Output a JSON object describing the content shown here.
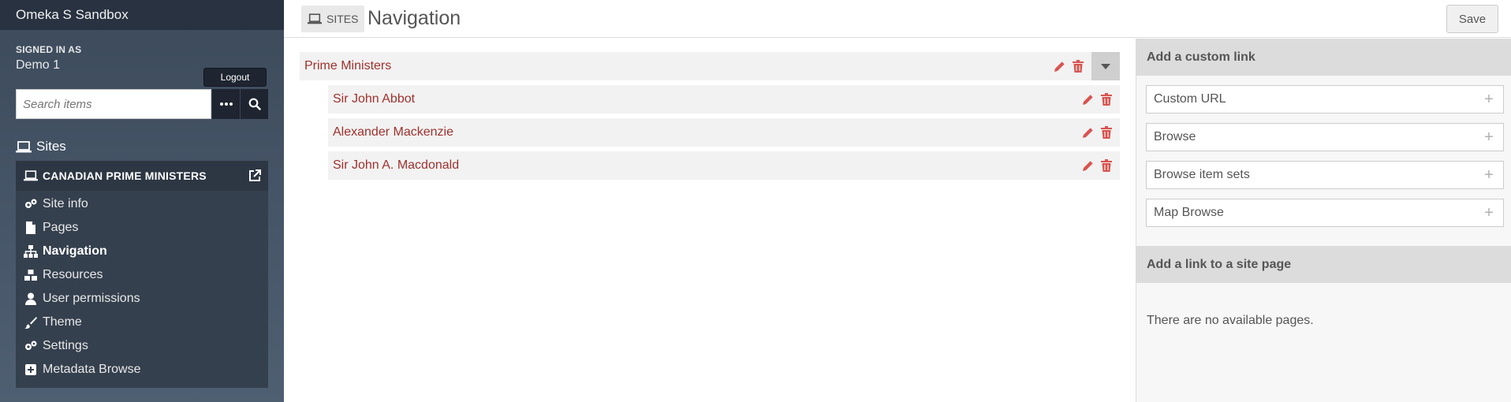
{
  "app": {
    "title": "Omeka S Sandbox"
  },
  "user": {
    "signed_in_label": "SIGNED IN AS",
    "name": "Demo 1",
    "logout_label": "Logout"
  },
  "search": {
    "placeholder": "Search items"
  },
  "sidebar": {
    "sites_label": "Sites",
    "current_site": "CANADIAN PRIME MINISTERS",
    "items": [
      {
        "label": "Site info",
        "icon": "gears-icon"
      },
      {
        "label": "Pages",
        "icon": "file-icon"
      },
      {
        "label": "Navigation",
        "icon": "sitemap-icon"
      },
      {
        "label": "Resources",
        "icon": "cubes-icon"
      },
      {
        "label": "User permissions",
        "icon": "user-icon"
      },
      {
        "label": "Theme",
        "icon": "brush-icon"
      },
      {
        "label": "Settings",
        "icon": "gears-icon"
      },
      {
        "label": "Metadata Browse",
        "icon": "plus-square-icon"
      }
    ]
  },
  "header": {
    "breadcrumb": "SITES",
    "title": "Navigation",
    "save_label": "Save"
  },
  "navigation": {
    "root": "Prime Ministers",
    "children": [
      "Sir John Abbot",
      "Alexander Mackenzie",
      "Sir John A. Macdonald"
    ]
  },
  "right_panel": {
    "custom_link_heading": "Add a custom link",
    "custom_links": [
      "Custom URL",
      "Browse",
      "Browse item sets",
      "Map Browse"
    ],
    "site_page_heading": "Add a link to a site page",
    "empty_message": "There are no available pages."
  },
  "colors": {
    "sidebar_bg": "#45536a",
    "link_red": "#a0312d",
    "action_red": "#d9534f"
  }
}
